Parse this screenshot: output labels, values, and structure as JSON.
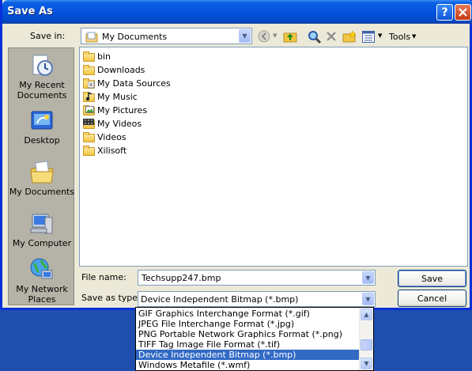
{
  "window": {
    "title": "Save As"
  },
  "toolbar": {
    "save_in_label": "Save in:",
    "save_in_value": "My Documents",
    "tools_label": "Tools"
  },
  "places": [
    {
      "label1": "My Recent",
      "label2": "Documents"
    },
    {
      "label1": "Desktop",
      "label2": ""
    },
    {
      "label1": "My Documents",
      "label2": ""
    },
    {
      "label1": "My Computer",
      "label2": ""
    },
    {
      "label1": "My Network",
      "label2": "Places"
    }
  ],
  "files": [
    {
      "name": "bin",
      "icon": "folder-icon"
    },
    {
      "name": "Downloads",
      "icon": "folder-icon"
    },
    {
      "name": "My Data Sources",
      "icon": "data-sources-folder-icon"
    },
    {
      "name": "My Music",
      "icon": "music-folder-icon"
    },
    {
      "name": "My Pictures",
      "icon": "pictures-folder-icon"
    },
    {
      "name": "My Videos",
      "icon": "videos-folder-icon"
    },
    {
      "name": "Videos",
      "icon": "folder-icon"
    },
    {
      "name": "Xilisoft",
      "icon": "folder-icon"
    }
  ],
  "form": {
    "file_name_label": "File name:",
    "file_name_value": "Techsupp247.bmp",
    "save_as_type_label": "Save as type:",
    "save_as_type_value": "Device Independent Bitmap (*.bmp)"
  },
  "buttons": {
    "save": "Save",
    "cancel": "Cancel"
  },
  "type_options": [
    "GIF Graphics Interchange Format (*.gif)",
    "JPEG File Interchange Format (*.jpg)",
    "PNG Portable Network Graphics Format (*.png)",
    "TIFF Tag Image File Format (*.tif)",
    "Device Independent Bitmap (*.bmp)",
    "Windows Metafile (*.wmf)"
  ],
  "colors": {
    "title_blue": "#0553de",
    "selection": "#316ac5",
    "dialog_bg": "#ece9d8"
  }
}
